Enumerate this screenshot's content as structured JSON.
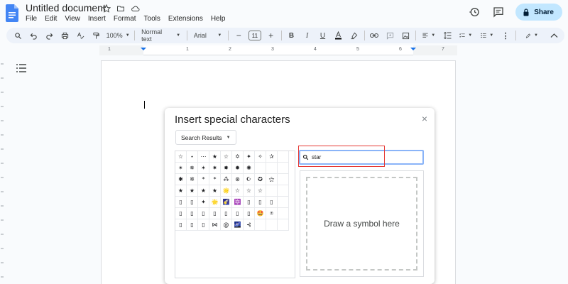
{
  "doc": {
    "title": "Untitled document",
    "menu": [
      "File",
      "Edit",
      "View",
      "Insert",
      "Format",
      "Tools",
      "Extensions",
      "Help"
    ]
  },
  "header": {
    "share_label": "Share"
  },
  "toolbar": {
    "zoom": "100%",
    "style": "Normal text",
    "font": "Arial",
    "font_size": "11"
  },
  "ruler": {
    "labels": [
      "1",
      "1",
      "2",
      "3",
      "4",
      "5",
      "6",
      "7"
    ]
  },
  "dialog": {
    "title": "Insert special characters",
    "category": "Search Results",
    "search_value": "star",
    "draw_prompt": "Draw a symbol here",
    "close_glyph": "×",
    "characters": [
      [
        "☆",
        "⋆",
        "⋯",
        "★",
        "☆",
        "✡",
        "✦",
        "✧",
        "✰",
        "",
        ""
      ],
      [
        "✴",
        "✵",
        "✶",
        "✷",
        "✸",
        "✹",
        "✺",
        "",
        "",
        "",
        ""
      ],
      [
        "✱",
        "✲",
        "*",
        "*",
        "⁂",
        "⊛",
        "☪",
        "✪",
        "⚝",
        "",
        ""
      ],
      [
        "★",
        "★",
        "★",
        "★",
        "🌟",
        "☆",
        "☆",
        "☆",
        "",
        "",
        ""
      ],
      [
        "▯",
        "▯",
        "✦",
        "🌟",
        "🌠",
        "🔯",
        "▯",
        "▯",
        "▯",
        "",
        ""
      ],
      [
        "▯",
        "▯",
        "▯",
        "▯",
        "▯",
        "▯",
        "▯",
        "🤩",
        "⍟",
        "",
        ""
      ],
      [
        "▯",
        "▯",
        "▯",
        "⋈",
        "@",
        "🌌",
        "⊰",
        "",
        "",
        "",
        ""
      ]
    ]
  },
  "colors": {
    "accent": "#1a73e8",
    "share_bg": "#c2e7ff",
    "highlight": "#e53935"
  }
}
